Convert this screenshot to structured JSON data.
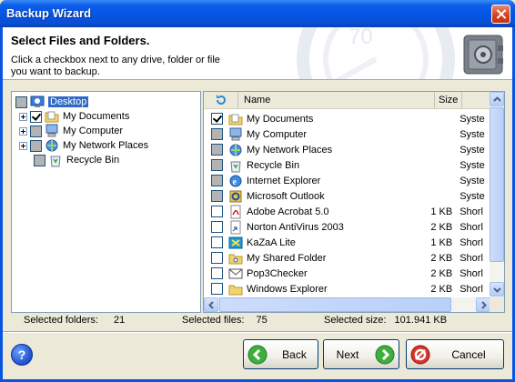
{
  "window": {
    "title": "Backup Wizard"
  },
  "header": {
    "title": "Select Files and Folders.",
    "description": "Click a checkbox next to any drive, folder or file you want to backup."
  },
  "tree": {
    "items": [
      {
        "label": "Desktop",
        "icon": "desktop-icon",
        "state": "grey",
        "selected": true
      },
      {
        "label": "My Documents",
        "icon": "folder-documents-icon",
        "state": "checked"
      },
      {
        "label": "My Computer",
        "icon": "computer-icon",
        "state": "grey"
      },
      {
        "label": "My Network Places",
        "icon": "network-places-icon",
        "state": "grey"
      },
      {
        "label": "Recycle Bin",
        "icon": "recycle-bin-icon",
        "state": "grey"
      }
    ]
  },
  "list": {
    "columns": {
      "name": "Name",
      "size": "Size"
    },
    "rows": [
      {
        "name": "My Documents",
        "size": "",
        "type": "Syste",
        "state": "checked",
        "icon": "folder-documents-icon"
      },
      {
        "name": "My Computer",
        "size": "",
        "type": "Syste",
        "state": "grey",
        "icon": "computer-icon"
      },
      {
        "name": "My Network Places",
        "size": "",
        "type": "Syste",
        "state": "grey",
        "icon": "network-places-icon"
      },
      {
        "name": "Recycle Bin",
        "size": "",
        "type": "Syste",
        "state": "grey",
        "icon": "recycle-bin-icon"
      },
      {
        "name": "Internet Explorer",
        "size": "",
        "type": "Syste",
        "state": "grey",
        "icon": "internet-explorer-icon"
      },
      {
        "name": "Microsoft Outlook",
        "size": "",
        "type": "Syste",
        "state": "grey",
        "icon": "outlook-icon"
      },
      {
        "name": "Adobe Acrobat 5.0",
        "size": "1 KB",
        "type": "Shorl",
        "state": "unchecked",
        "icon": "acrobat-icon"
      },
      {
        "name": "Norton AntiVirus 2003",
        "size": "2 KB",
        "type": "Shorl",
        "state": "unchecked",
        "icon": "shortcut-icon"
      },
      {
        "name": "KaZaA Lite",
        "size": "1 KB",
        "type": "Shorl",
        "state": "unchecked",
        "icon": "kazaa-icon"
      },
      {
        "name": "My Shared Folder",
        "size": "2 KB",
        "type": "Shorl",
        "state": "unchecked",
        "icon": "shared-folder-icon"
      },
      {
        "name": "Pop3Checker",
        "size": "2 KB",
        "type": "Shorl",
        "state": "unchecked",
        "icon": "pop3-icon"
      },
      {
        "name": "Windows Explorer",
        "size": "2 KB",
        "type": "Shorl",
        "state": "unchecked",
        "icon": "folder-icon"
      }
    ]
  },
  "status": {
    "folders_label": "Selected folders:",
    "folders_value": "21",
    "files_label": "Selected files:",
    "files_value": "75",
    "size_label": "Selected size:",
    "size_value": "101.941 KB"
  },
  "buttons": {
    "help": "?",
    "back": "Back",
    "next": "Next",
    "cancel": "Cancel"
  },
  "colors": {
    "titlebar": "#0554e3",
    "selection": "#316ac5",
    "dialog": "#ece9d8"
  }
}
